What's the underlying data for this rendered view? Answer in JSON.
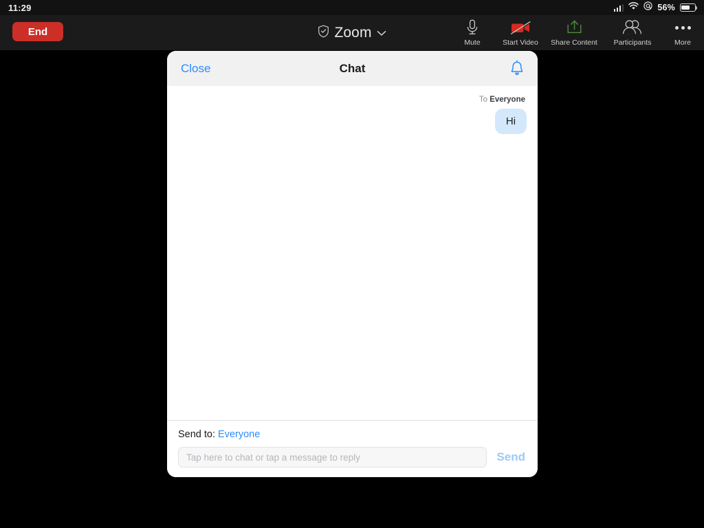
{
  "status_bar": {
    "time": "11:29",
    "battery_percent": "56%",
    "icons": [
      "cellular-signal-icon",
      "wifi-icon",
      "orientation-lock-icon",
      "battery-icon"
    ]
  },
  "topbar": {
    "end_button_label": "End",
    "meeting_title": "Zoom",
    "shield_icon": "shield-check-icon",
    "chevron_icon": "chevron-down-icon",
    "tools": [
      {
        "id": "mute",
        "label": "Mute",
        "icon": "microphone-icon"
      },
      {
        "id": "start-video",
        "label": "Start Video",
        "icon": "video-camera-off-icon"
      },
      {
        "id": "share-content",
        "label": "Share Content",
        "icon": "share-upload-icon"
      },
      {
        "id": "participants",
        "label": "Participants",
        "icon": "people-icon"
      },
      {
        "id": "more",
        "label": "More",
        "icon": "ellipsis-icon"
      }
    ]
  },
  "chat": {
    "close_label": "Close",
    "title": "Chat",
    "bell_icon": "notification-bell-icon",
    "messages": [
      {
        "recipient_prefix": "To ",
        "recipient": "Everyone",
        "text": "Hi",
        "align": "right"
      }
    ],
    "footer": {
      "send_to_label": "Send to:",
      "send_to_target": "Everyone",
      "input_value": "",
      "input_placeholder": "Tap here to chat or tap a message to reply",
      "send_label": "Send"
    }
  },
  "colors": {
    "end_red": "#cc2f28",
    "link_blue": "#2b8cff",
    "send_blue_disabled": "#9dc9f7",
    "bubble_blue": "#d3e8fb",
    "video_red": "#d32f2f",
    "share_green": "#4a8a3a",
    "topbar_dark": "#1b1b1b",
    "header_gray": "#f1f1f1"
  }
}
